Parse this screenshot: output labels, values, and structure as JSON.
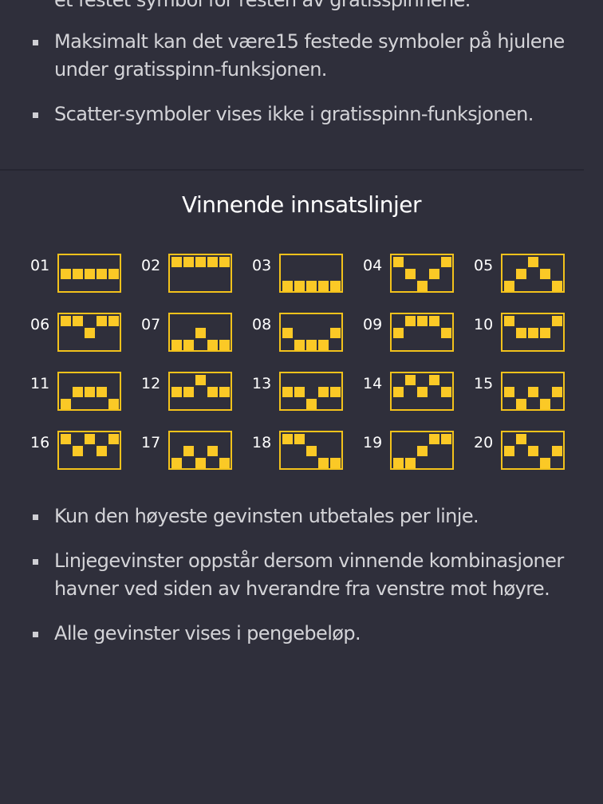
{
  "top_list": [
    "et festet symbol for resten av gratisspinnene.",
    "Maksimalt kan det være15 festede symboler på hjulene under gratisspinn-funksjonen.",
    "Scatter-symboler vises ikke i gratisspinn-funksjonen."
  ],
  "section_title": "Vinnende innsatslinjer",
  "accent_color": "#f3c21b",
  "paylines": [
    {
      "label": "01",
      "rows": [
        1,
        1,
        1,
        1,
        1
      ]
    },
    {
      "label": "02",
      "rows": [
        0,
        0,
        0,
        0,
        0
      ]
    },
    {
      "label": "03",
      "rows": [
        2,
        2,
        2,
        2,
        2
      ]
    },
    {
      "label": "04",
      "rows": [
        0,
        1,
        2,
        1,
        0
      ]
    },
    {
      "label": "05",
      "rows": [
        2,
        1,
        0,
        1,
        2
      ]
    },
    {
      "label": "06",
      "rows": [
        0,
        0,
        1,
        0,
        0
      ]
    },
    {
      "label": "07",
      "rows": [
        2,
        2,
        1,
        2,
        2
      ]
    },
    {
      "label": "08",
      "rows": [
        1,
        2,
        2,
        2,
        1
      ]
    },
    {
      "label": "09",
      "rows": [
        1,
        0,
        0,
        0,
        1
      ]
    },
    {
      "label": "10",
      "rows": [
        0,
        1,
        1,
        1,
        0
      ]
    },
    {
      "label": "11",
      "rows": [
        2,
        1,
        1,
        1,
        2
      ]
    },
    {
      "label": "12",
      "rows": [
        1,
        1,
        0,
        1,
        1
      ]
    },
    {
      "label": "13",
      "rows": [
        1,
        1,
        2,
        1,
        1
      ]
    },
    {
      "label": "14",
      "rows": [
        1,
        0,
        1,
        0,
        1
      ]
    },
    {
      "label": "15",
      "rows": [
        1,
        2,
        1,
        2,
        1
      ]
    },
    {
      "label": "16",
      "rows": [
        0,
        1,
        0,
        1,
        0
      ]
    },
    {
      "label": "17",
      "rows": [
        2,
        1,
        2,
        1,
        2
      ]
    },
    {
      "label": "18",
      "rows": [
        0,
        0,
        1,
        2,
        2
      ]
    },
    {
      "label": "19",
      "rows": [
        2,
        2,
        1,
        0,
        0
      ]
    },
    {
      "label": "20",
      "rows": [
        1,
        0,
        1,
        2,
        1
      ]
    }
  ],
  "bottom_list": [
    "Kun den høyeste gevinsten utbetales per linje.",
    "Linjegevinster oppstår dersom vinnende kombinasjoner havner ved siden av hverandre fra venstre mot høyre.",
    "Alle gevinster vises i pengebeløp."
  ]
}
